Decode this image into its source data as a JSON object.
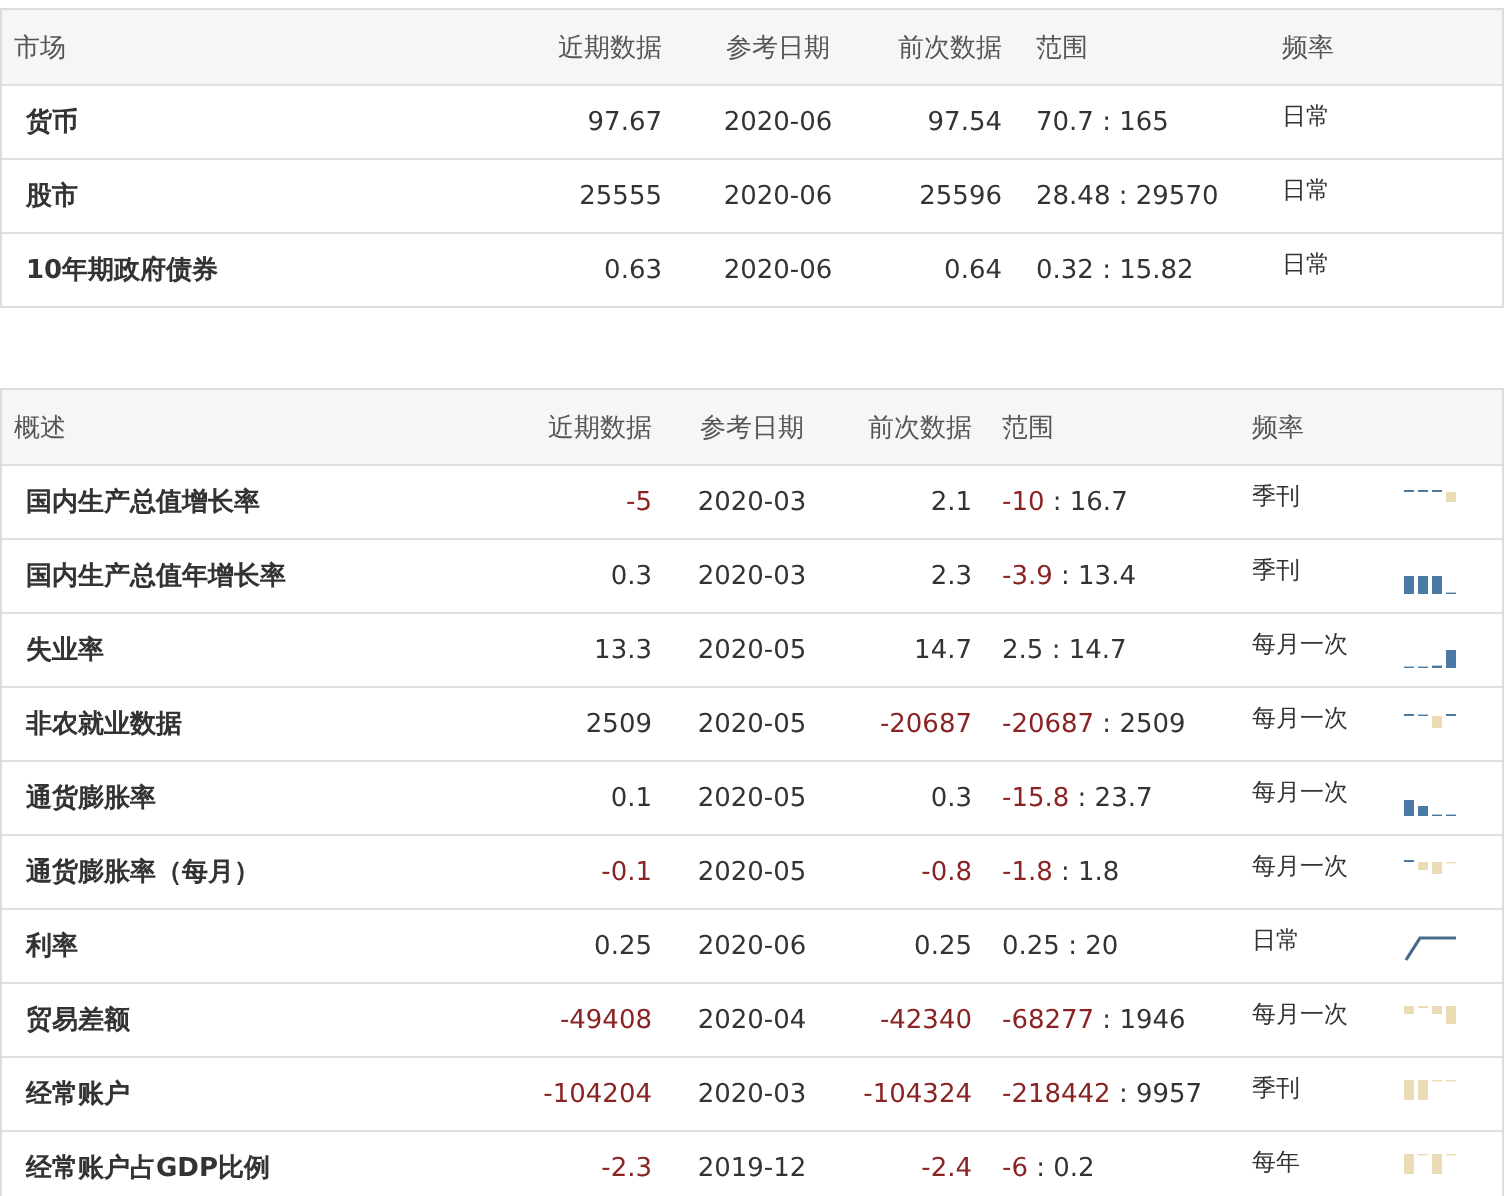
{
  "markets": {
    "columns": [
      "市场",
      "近期数据",
      "参考日期",
      "前次数据",
      "范围",
      "频率"
    ],
    "rows": [
      {
        "name": "货币",
        "latest": {
          "text": "97.67",
          "negative": false
        },
        "date": "2020-06",
        "previous": {
          "text": "97.54",
          "negative": false
        },
        "range": {
          "low": {
            "text": "70.7",
            "negative": false
          },
          "separator": ":",
          "high": {
            "text": "165",
            "negative": false
          }
        },
        "frequency": "日常"
      },
      {
        "name": "股市",
        "latest": {
          "text": "25555",
          "negative": false
        },
        "date": "2020-06",
        "previous": {
          "text": "25596",
          "negative": false
        },
        "range": {
          "low": {
            "text": "28.48",
            "negative": false
          },
          "separator": ":",
          "high": {
            "text": "29570",
            "negative": false
          }
        },
        "frequency": "日常"
      },
      {
        "name": "10年期政府债券",
        "latest": {
          "text": "0.63",
          "negative": false
        },
        "date": "2020-06",
        "previous": {
          "text": "0.64",
          "negative": false
        },
        "range": {
          "low": {
            "text": "0.32",
            "negative": false
          },
          "separator": ":",
          "high": {
            "text": "15.82",
            "negative": false
          }
        },
        "frequency": "日常"
      }
    ]
  },
  "overview": {
    "columns": [
      "概述",
      "近期数据",
      "参考日期",
      "前次数据",
      "范围",
      "频率"
    ],
    "rows": [
      {
        "name": "国内生产总值增长率",
        "latest": {
          "text": "-5",
          "negative": true
        },
        "date": "2020-03",
        "previous": {
          "text": "2.1",
          "negative": false
        },
        "range": {
          "low": {
            "text": "-10",
            "negative": true
          },
          "separator": ":",
          "high": {
            "text": "16.7",
            "negative": false
          }
        },
        "frequency": "季刊",
        "kind": "bars"
      },
      {
        "name": "国内生产总值年增长率",
        "latest": {
          "text": "0.3",
          "negative": false
        },
        "date": "2020-03",
        "previous": {
          "text": "2.3",
          "negative": false
        },
        "range": {
          "low": {
            "text": "-3.9",
            "negative": true
          },
          "separator": ":",
          "high": {
            "text": "13.4",
            "negative": false
          }
        },
        "frequency": "季刊",
        "kind": "bars"
      },
      {
        "name": "失业率",
        "latest": {
          "text": "13.3",
          "negative": false
        },
        "date": "2020-05",
        "previous": {
          "text": "14.7",
          "negative": false
        },
        "range": {
          "low": {
            "text": "2.5",
            "negative": false
          },
          "separator": ":",
          "high": {
            "text": "14.7",
            "negative": false
          }
        },
        "frequency": "每月一次",
        "kind": "bars"
      },
      {
        "name": "非农就业数据",
        "latest": {
          "text": "2509",
          "negative": false
        },
        "date": "2020-05",
        "previous": {
          "text": "-20687",
          "negative": true
        },
        "range": {
          "low": {
            "text": "-20687",
            "negative": true
          },
          "separator": ":",
          "high": {
            "text": "2509",
            "negative": false
          }
        },
        "frequency": "每月一次",
        "kind": "bars"
      },
      {
        "name": "通货膨胀率",
        "latest": {
          "text": "0.1",
          "negative": false
        },
        "date": "2020-05",
        "previous": {
          "text": "0.3",
          "negative": false
        },
        "range": {
          "low": {
            "text": "-15.8",
            "negative": true
          },
          "separator": ":",
          "high": {
            "text": "23.7",
            "negative": false
          }
        },
        "frequency": "每月一次",
        "kind": "bars"
      },
      {
        "name": "通货膨胀率（每月）",
        "latest": {
          "text": "-0.1",
          "negative": true
        },
        "date": "2020-05",
        "previous": {
          "text": "-0.8",
          "negative": true
        },
        "range": {
          "low": {
            "text": "-1.8",
            "negative": true
          },
          "separator": ":",
          "high": {
            "text": "1.8",
            "negative": false
          }
        },
        "frequency": "每月一次",
        "kind": "bars"
      },
      {
        "name": "利率",
        "latest": {
          "text": "0.25",
          "negative": false
        },
        "date": "2020-06",
        "previous": {
          "text": "0.25",
          "negative": false
        },
        "range": {
          "low": {
            "text": "0.25",
            "negative": false
          },
          "separator": ":",
          "high": {
            "text": "20",
            "negative": false
          }
        },
        "frequency": "日常",
        "kind": "line"
      },
      {
        "name": "贸易差额",
        "latest": {
          "text": "-49408",
          "negative": true
        },
        "date": "2020-04",
        "previous": {
          "text": "-42340",
          "negative": true
        },
        "range": {
          "low": {
            "text": "-68277",
            "negative": true
          },
          "separator": ":",
          "high": {
            "text": "1946",
            "negative": false
          }
        },
        "frequency": "每月一次",
        "kind": "bars"
      },
      {
        "name": "经常账户",
        "latest": {
          "text": "-104204",
          "negative": true
        },
        "date": "2020-03",
        "previous": {
          "text": "-104324",
          "negative": true
        },
        "range": {
          "low": {
            "text": "-218442",
            "negative": true
          },
          "separator": ":",
          "high": {
            "text": "9957",
            "negative": false
          }
        },
        "frequency": "季刊",
        "kind": "bars"
      },
      {
        "name": "经常账户占GDP比例",
        "latest": {
          "text": "-2.3",
          "negative": true
        },
        "date": "2019-12",
        "previous": {
          "text": "-2.4",
          "negative": true
        },
        "range": {
          "low": {
            "text": "-6",
            "negative": true
          },
          "separator": ":",
          "high": {
            "text": "0.2",
            "negative": false
          }
        },
        "frequency": "每年",
        "kind": "bars"
      }
    ]
  }
}
